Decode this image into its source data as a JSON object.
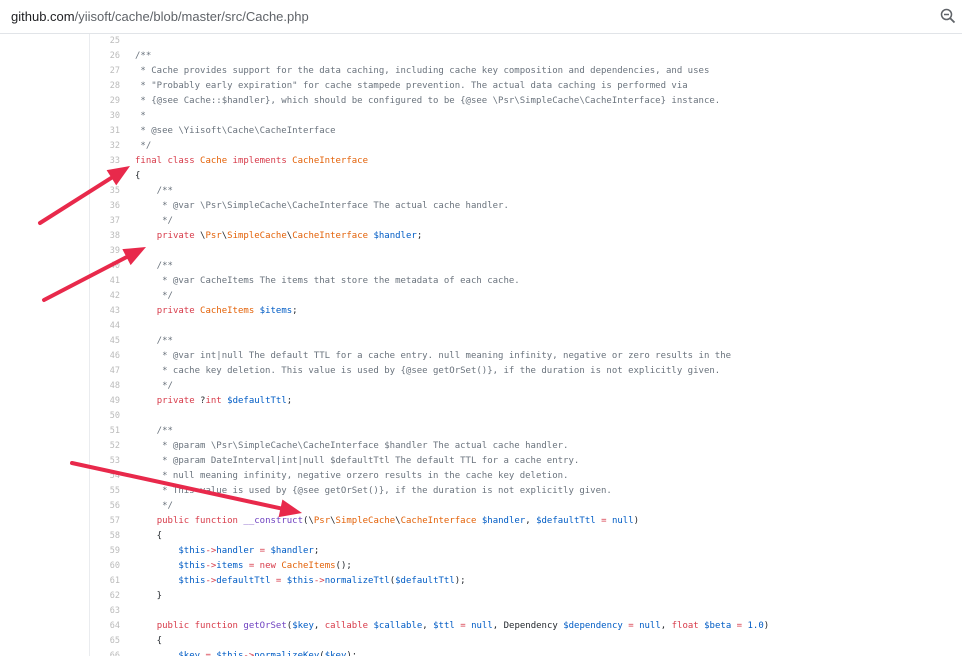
{
  "address_bar": {
    "host": "github.com",
    "path": "/yiisoft/cache/blob/master/src/Cache.php",
    "zoom_icon": "magnifier-minus-icon"
  },
  "annotation_color": "#e8294b",
  "code": {
    "lines": [
      {
        "n": "25",
        "t": ""
      },
      {
        "n": "26",
        "t": "/**"
      },
      {
        "n": "27",
        "t": " * Cache provides support for the data caching, including cache key composition and dependencies, and uses"
      },
      {
        "n": "28",
        "t": " * \"Probably early expiration\" for cache stampede prevention. The actual data caching is performed via"
      },
      {
        "n": "29",
        "t": " * {@see Cache::$handler}, which should be configured to be {@see \\Psr\\SimpleCache\\CacheInterface} instance."
      },
      {
        "n": "30",
        "t": " *"
      },
      {
        "n": "31",
        "t": " * @see \\Yiisoft\\Cache\\CacheInterface"
      },
      {
        "n": "32",
        "t": " */"
      },
      {
        "n": "33",
        "t": "final class Cache implements CacheInterface"
      },
      {
        "n": "34",
        "t": "{"
      },
      {
        "n": "35",
        "t": "    /**"
      },
      {
        "n": "36",
        "t": "     * @var \\Psr\\SimpleCache\\CacheInterface The actual cache handler."
      },
      {
        "n": "37",
        "t": "     */"
      },
      {
        "n": "38",
        "t": "    private \\Psr\\SimpleCache\\CacheInterface $handler;"
      },
      {
        "n": "39",
        "t": ""
      },
      {
        "n": "40",
        "t": "    /**"
      },
      {
        "n": "41",
        "t": "     * @var CacheItems The items that store the metadata of each cache."
      },
      {
        "n": "42",
        "t": "     */"
      },
      {
        "n": "43",
        "t": "    private CacheItems $items;"
      },
      {
        "n": "44",
        "t": ""
      },
      {
        "n": "45",
        "t": "    /**"
      },
      {
        "n": "46",
        "t": "     * @var int|null The default TTL for a cache entry. null meaning infinity, negative or zero results in the"
      },
      {
        "n": "47",
        "t": "     * cache key deletion. This value is used by {@see getOrSet()}, if the duration is not explicitly given."
      },
      {
        "n": "48",
        "t": "     */"
      },
      {
        "n": "49",
        "t": "    private ?int $defaultTtl;"
      },
      {
        "n": "50",
        "t": ""
      },
      {
        "n": "51",
        "t": "    /**"
      },
      {
        "n": "52",
        "t": "     * @param \\Psr\\SimpleCache\\CacheInterface $handler The actual cache handler."
      },
      {
        "n": "53",
        "t": "     * @param DateInterval|int|null $defaultTtl The default TTL for a cache entry."
      },
      {
        "n": "54",
        "t": "     * null meaning infinity, negative orzero results in the cache key deletion."
      },
      {
        "n": "55",
        "t": "     * This value is used by {@see getOrSet()}, if the duration is not explicitly given."
      },
      {
        "n": "56",
        "t": "     */"
      },
      {
        "n": "57",
        "t": "    public function __construct(\\Psr\\SimpleCache\\CacheInterface $handler, $defaultTtl = null)"
      },
      {
        "n": "58",
        "t": "    {"
      },
      {
        "n": "59",
        "t": "        $this->handler = $handler;"
      },
      {
        "n": "60",
        "t": "        $this->items = new CacheItems();"
      },
      {
        "n": "61",
        "t": "        $this->defaultTtl = $this->normalizeTtl($defaultTtl);"
      },
      {
        "n": "62",
        "t": "    }"
      },
      {
        "n": "63",
        "t": ""
      },
      {
        "n": "64",
        "t": "    public function getOrSet($key, callable $callable, $ttl = null, Dependency $dependency = null, float $beta = 1.0)"
      },
      {
        "n": "65",
        "t": "    {"
      },
      {
        "n": "66",
        "t": "        $key = $this->normalizeKey($key);"
      }
    ]
  }
}
